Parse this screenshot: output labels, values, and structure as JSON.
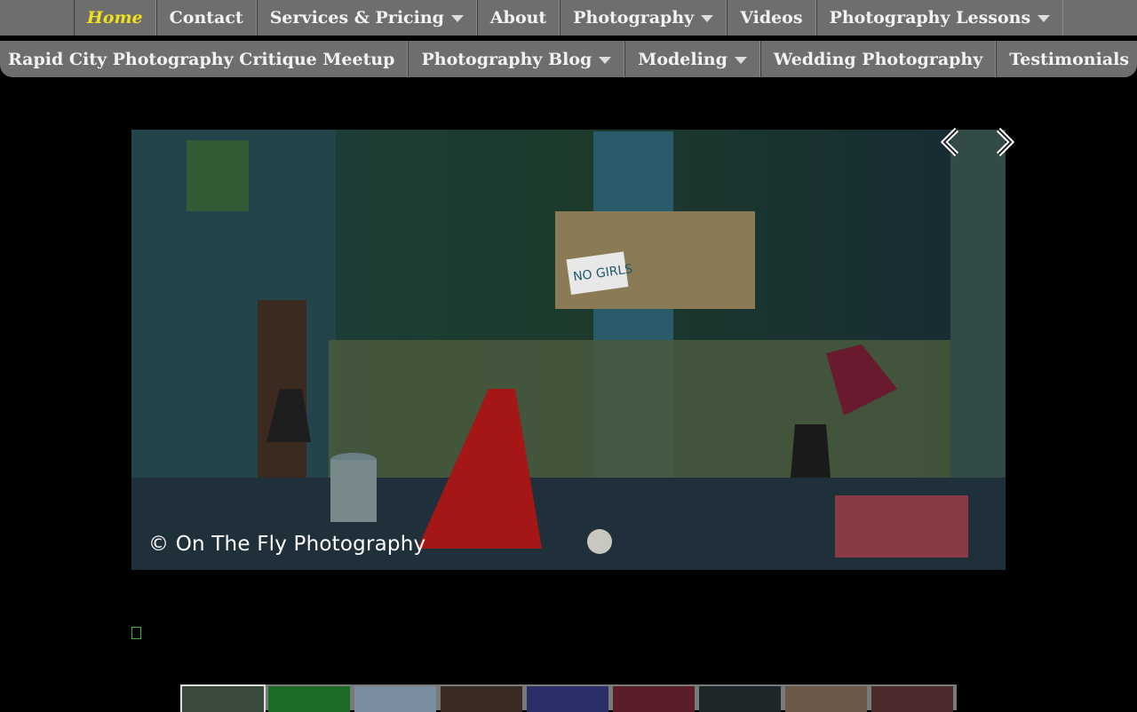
{
  "nav_top": [
    {
      "label": "Home",
      "active": true
    },
    {
      "label": "Contact"
    },
    {
      "label": "Services & Pricing",
      "dropdown": true
    },
    {
      "label": "About"
    },
    {
      "label": "Photography",
      "dropdown": true
    },
    {
      "label": "Videos"
    },
    {
      "label": "Photography Lessons",
      "dropdown": true
    }
  ],
  "nav_bottom": [
    {
      "label": "Rapid City Photography Critique Meetup"
    },
    {
      "label": "Photography Blog",
      "dropdown": true
    },
    {
      "label": "Modeling",
      "dropdown": true
    },
    {
      "label": "Wedding Photography"
    },
    {
      "label": "Testimonials"
    }
  ],
  "hero": {
    "caption": "© On The Fly Photography",
    "sign_text": "NO GIRLS"
  },
  "colors": {
    "nav_bg": "#6e6e6e",
    "active": "#f0e11e",
    "page_bg": "#000000"
  },
  "thumbnails": [
    {
      "name": "thumb-1",
      "color": "#3a4a3c"
    },
    {
      "name": "thumb-2",
      "color": "#1d6b27"
    },
    {
      "name": "thumb-3",
      "color": "#7a8ea0"
    },
    {
      "name": "thumb-4",
      "color": "#3a2a24"
    },
    {
      "name": "thumb-5",
      "color": "#2a2f6a"
    },
    {
      "name": "thumb-6",
      "color": "#5a1d2a"
    },
    {
      "name": "thumb-7",
      "color": "#20272a"
    },
    {
      "name": "thumb-8",
      "color": "#6b5a4a"
    },
    {
      "name": "thumb-9",
      "color": "#4a2a2a"
    }
  ]
}
